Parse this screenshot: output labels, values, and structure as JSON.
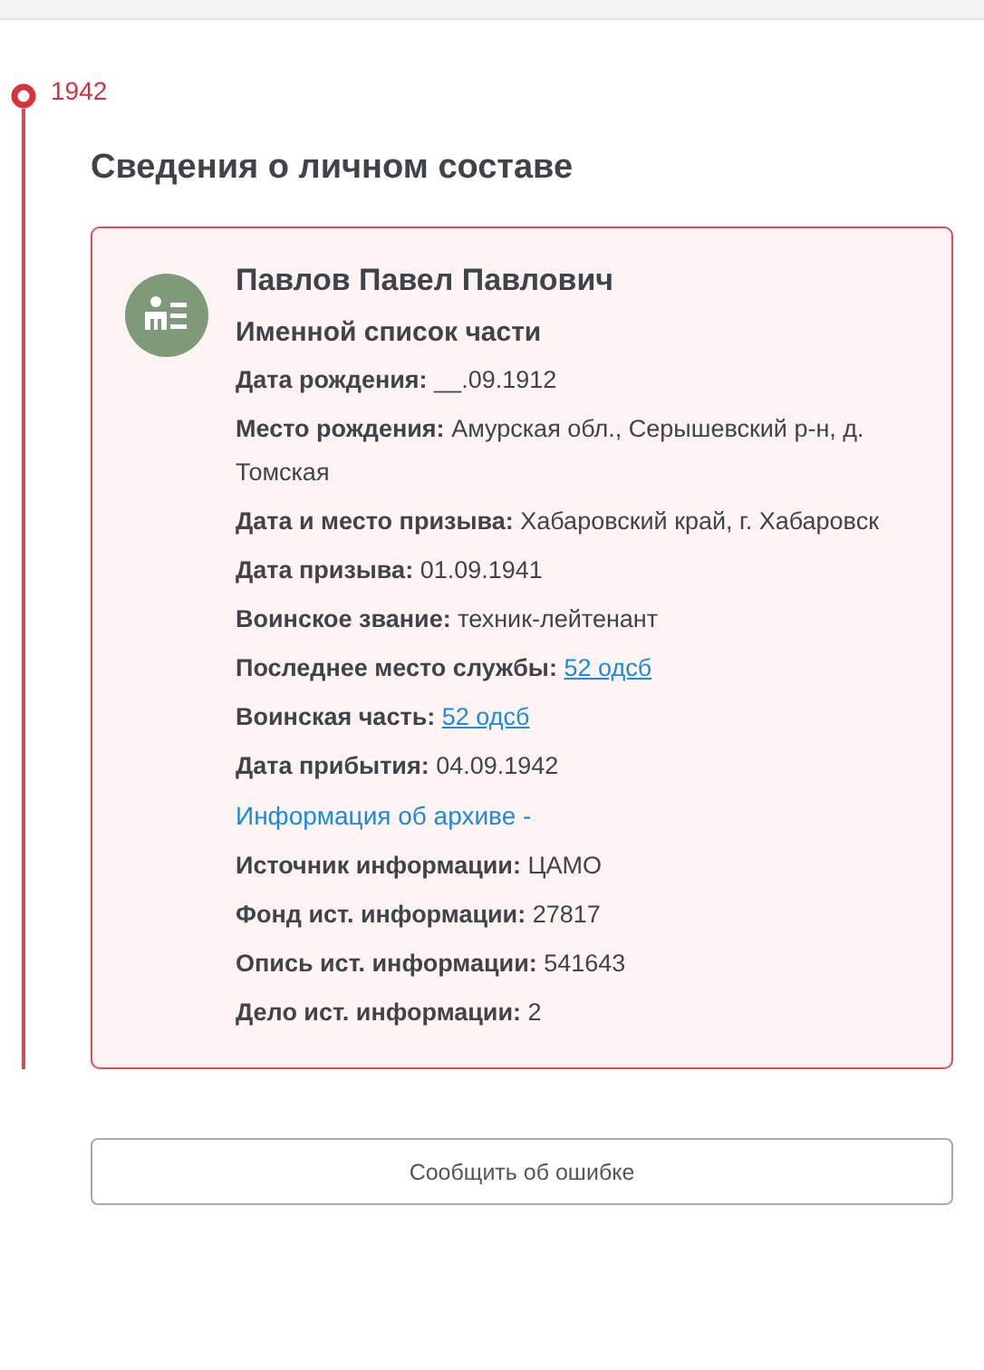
{
  "timeline": {
    "year": "1942"
  },
  "section": {
    "title": "Сведения о личном составе"
  },
  "card": {
    "name": "Павлов Павел Павлович",
    "subtitle": "Именной список части",
    "rows": [
      {
        "kind": "field",
        "label": "Дата рождения:",
        "value": "__.09.1912"
      },
      {
        "kind": "field",
        "label": "Место рождения:",
        "value": "Амурская обл., Серышевский р-н, д. Томская"
      },
      {
        "kind": "field",
        "label": "Дата и место призыва:",
        "value": "Хабаровский край, г. Хабаровск"
      },
      {
        "kind": "field",
        "label": "Дата призыва:",
        "value": "01.09.1941"
      },
      {
        "kind": "field",
        "label": "Воинское звание:",
        "value": "техник-лейтенант"
      },
      {
        "kind": "link_field",
        "label": "Последнее место службы:",
        "value": "52 одсб"
      },
      {
        "kind": "link_field",
        "label": "Воинская часть:",
        "value": "52 одсб"
      },
      {
        "kind": "field",
        "label": "Дата прибытия:",
        "value": "04.09.1942"
      },
      {
        "kind": "archive_link",
        "value": "Информация об архиве -"
      },
      {
        "kind": "field",
        "label": "Источник информации:",
        "value": "ЦАМО"
      },
      {
        "kind": "field",
        "label": "Фонд ист. информации:",
        "value": "27817"
      },
      {
        "kind": "field",
        "label": "Опись ист. информации:",
        "value": "541643"
      },
      {
        "kind": "field",
        "label": "Дело ист. информации:",
        "value": "2"
      }
    ]
  },
  "report_button": {
    "label": "Сообщить об ошибке"
  }
}
